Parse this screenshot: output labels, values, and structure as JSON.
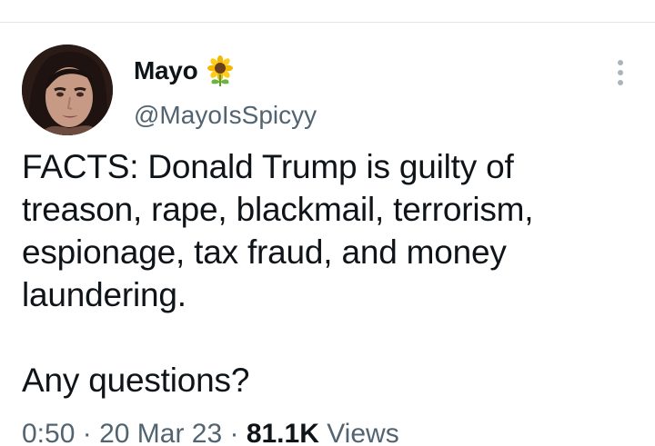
{
  "author": {
    "display_name": "Mayo",
    "name_emoji": "sunflower-icon",
    "handle": "@MayoIsSpicyy"
  },
  "tweet": {
    "paragraphs": [
      "FACTS: Donald Trump is guilty of treason, rape, blackmail, terrorism, espionage, tax fraud, and money laundering.",
      "Any questions?"
    ]
  },
  "meta": {
    "time": "0:50",
    "separator": " · ",
    "date": "20 Mar 23",
    "views_count": "81.1K",
    "views_label": " Views"
  },
  "colors": {
    "text_primary": "#0f1419",
    "text_secondary": "#536471",
    "divider": "#e6e6e6",
    "more_dots": "#aab4bd"
  }
}
